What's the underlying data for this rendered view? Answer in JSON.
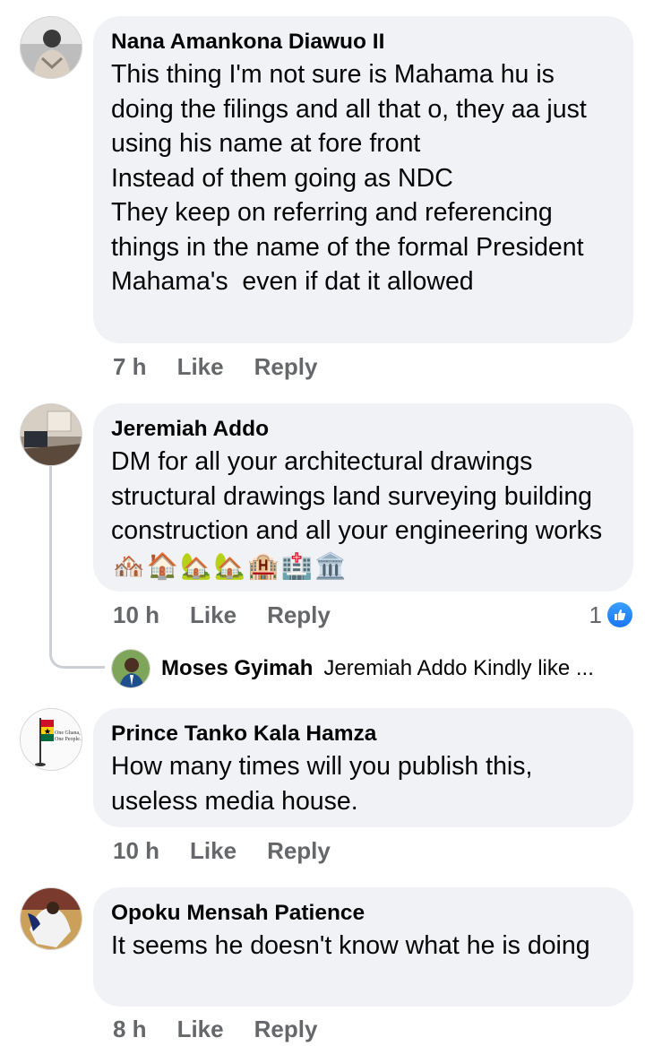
{
  "comments": [
    {
      "author": "Nana Amankona Diawuo II",
      "text": "This thing I'm not sure is Mahama hu is doing the filings and all that o, they aa just using his name at fore front\nInstead of them going as NDC\nThey keep on referring and referencing things in the name of the formal President Mahama's  even if dat it allowed",
      "time": "7 h",
      "like_label": "Like",
      "reply_label": "Reply"
    },
    {
      "author": "Jeremiah Addo",
      "text": "DM for all your architectural drawings structural drawings land surveying building construction and all your engineering works",
      "emojis": [
        "🏘️",
        "🏠",
        "🏡",
        "🏡",
        "🏨",
        "🏥",
        "🏛️"
      ],
      "time": "10 h",
      "like_label": "Like",
      "reply_label": "Reply",
      "reaction_count": "1",
      "reply_preview": {
        "author": "Moses Gyimah",
        "text": "Jeremiah Addo Kindly like ..."
      }
    },
    {
      "author": "Prince Tanko Kala Hamza",
      "text": "How many times will you publish this, useless media house.",
      "time": "10 h",
      "like_label": "Like",
      "reply_label": "Reply",
      "avatar_text": "One Ghana, One People."
    },
    {
      "author": "Opoku Mensah Patience",
      "text": "It seems he doesn't know what he is doing",
      "time": "8 h",
      "like_label": "Like",
      "reply_label": "Reply"
    }
  ],
  "colors": {
    "bubble": "#f0f2f5",
    "meta_text": "#65676b",
    "like_blue": "#1877f2"
  }
}
